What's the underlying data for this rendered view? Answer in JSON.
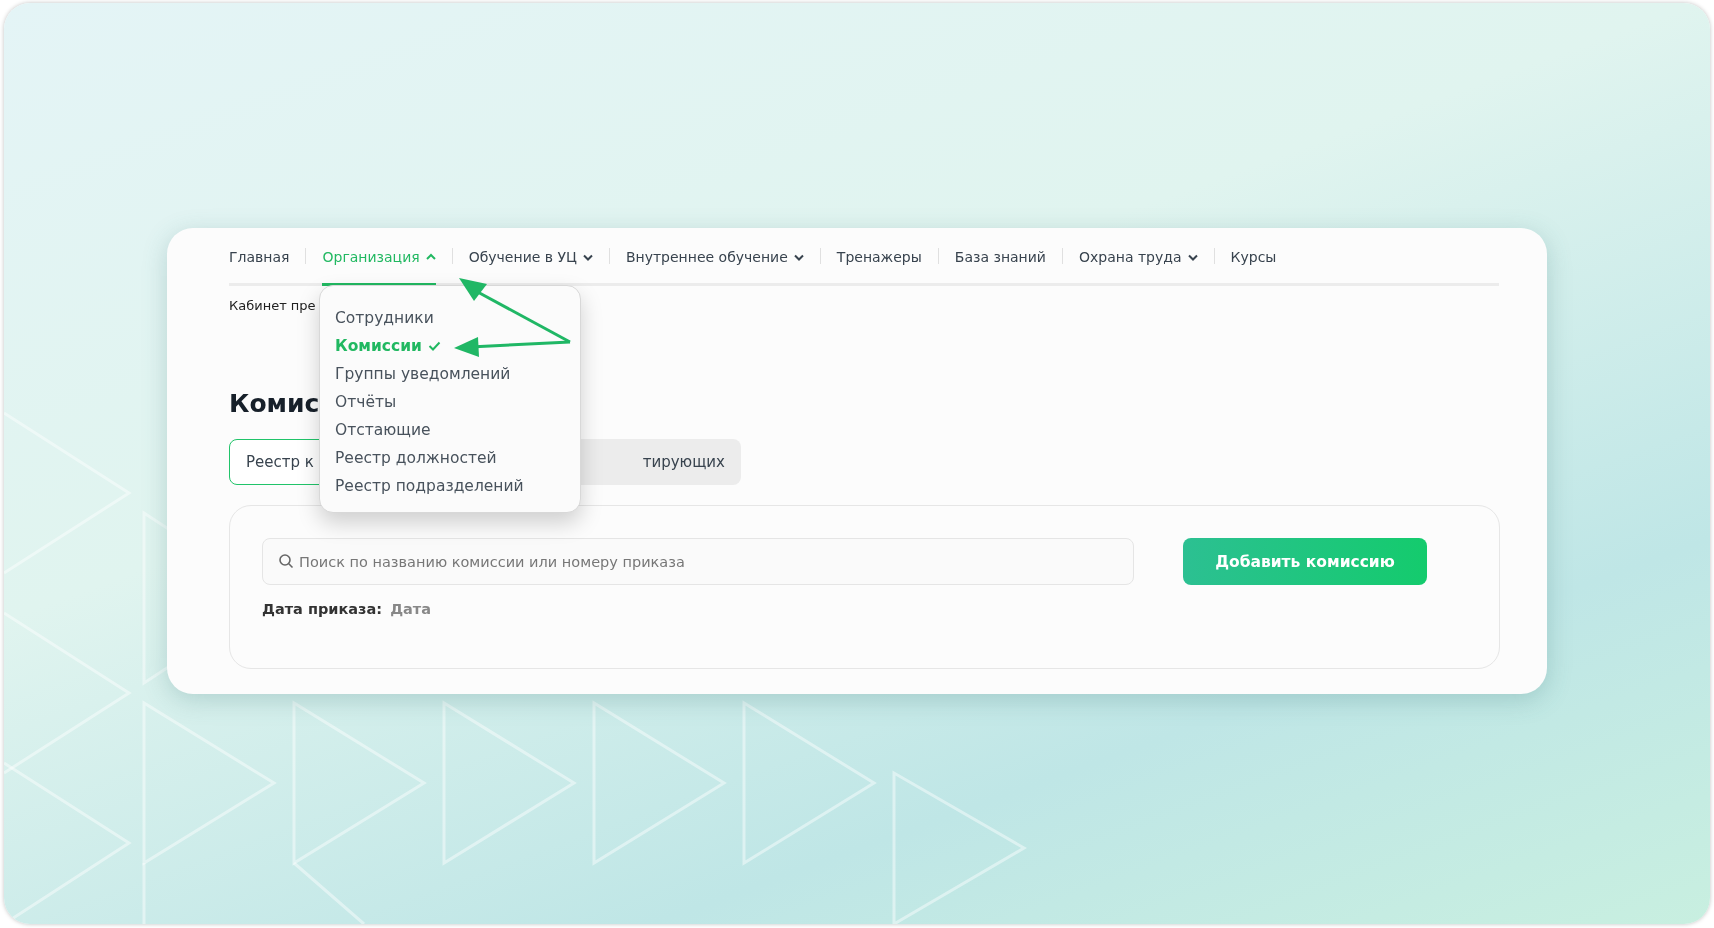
{
  "nav": [
    {
      "label": "Главная",
      "dropdown": false,
      "expanded": false,
      "selected": false
    },
    {
      "label": "Организация",
      "dropdown": true,
      "expanded": true,
      "selected": true
    },
    {
      "label": "Обучение в УЦ",
      "dropdown": true,
      "expanded": false,
      "selected": false
    },
    {
      "label": "Внутреннее обучение",
      "dropdown": true,
      "expanded": false,
      "selected": false
    },
    {
      "label": "Тренажеры",
      "dropdown": false,
      "expanded": false,
      "selected": false
    },
    {
      "label": "База знаний",
      "dropdown": false,
      "expanded": false,
      "selected": false
    },
    {
      "label": "Охрана труда",
      "dropdown": true,
      "expanded": false,
      "selected": false
    },
    {
      "label": "Курсы",
      "dropdown": false,
      "expanded": false,
      "selected": false
    }
  ],
  "menu": [
    {
      "label": "Сотрудники",
      "selected": false
    },
    {
      "label": "Комиссии",
      "selected": true
    },
    {
      "label": "Группы уведомлений",
      "selected": false
    },
    {
      "label": "Отчёты",
      "selected": false
    },
    {
      "label": "Отстающие",
      "selected": false
    },
    {
      "label": "Реестр должностей",
      "selected": false
    },
    {
      "label": "Реестр подразделений",
      "selected": false
    }
  ],
  "breadcrumb": "Кабинет пре",
  "title": "Комис",
  "tabs": [
    {
      "label": "Реестр к",
      "selected": true
    },
    {
      "label": "тирующих",
      "selected": false
    }
  ],
  "search": {
    "placeholder": "Поиск по названию комиссии или номеру приказа"
  },
  "add_button": "Добавить комиссию",
  "date_filter": {
    "label": "Дата приказа:",
    "value": "Дата"
  }
}
